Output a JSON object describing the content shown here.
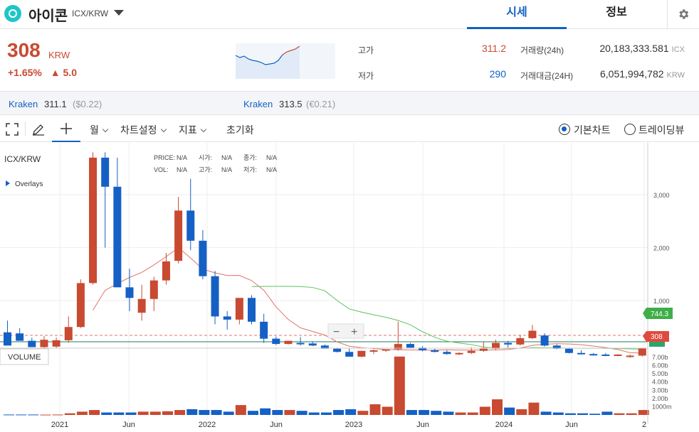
{
  "header": {
    "coin_name": "아이콘",
    "pair": "ICX/KRW",
    "tabs": [
      "시세",
      "정보"
    ],
    "active_tab": "시세"
  },
  "price": {
    "current": "308",
    "unit": "KRW",
    "change_pct": "+1.65%",
    "change_amount": "▲ 5.0"
  },
  "stats": {
    "high_label": "고가",
    "high": "311.2",
    "low_label": "저가",
    "low": "290",
    "volume_label": "거래량(24h)",
    "volume": "20,183,333.581",
    "volume_unit": "ICX",
    "amount_label": "거래대금(24H)",
    "amount": "6,051,994,782",
    "amount_unit": "KRW"
  },
  "exchanges": [
    {
      "name": "Kraken",
      "price": "311.1",
      "sub": "($0.22)"
    },
    {
      "name": "Kraken",
      "price": "313.5",
      "sub": "(€0.21)"
    }
  ],
  "toolbar": {
    "period": "월",
    "chart_settings": "차트설정",
    "indicators": "지표",
    "reset": "초기화",
    "basic_chart": "기본차트",
    "trading_view": "트레이딩뷰"
  },
  "chart_overlay": {
    "symbol": "ICX/KRW",
    "overlays": "Overlays",
    "price_label": "PRICE:",
    "price_val": "N/A",
    "open_label": "시가:",
    "open_val": "N/A",
    "close_label": "종가:",
    "close_val": "N/A",
    "vol_label": "VOL:",
    "vol_val": "N/A",
    "high_label": "고가:",
    "high_val": "N/A",
    "low_label": "저가:",
    "low_val": "N/A",
    "volume_panel": "VOLUME",
    "ma_badge": "744.3",
    "price_badge": "308",
    "zoom_out": "−",
    "zoom_in": "+"
  },
  "chart_data": {
    "type": "candlestick",
    "interval": "monthly",
    "price_ticks": [
      "3,000",
      "2,000",
      "1,000"
    ],
    "volume_ticks": [
      "7.00b",
      "6.00b",
      "5.00b",
      "4.00b",
      "3.00b",
      "2.00b",
      "1000m"
    ],
    "x_labels": [
      "2021",
      "Jun",
      "2022",
      "Jun",
      "2023",
      "Jun",
      "2024",
      "Jun",
      "2"
    ],
    "ylim": [
      0,
      3800
    ],
    "colors": {
      "up": "#c84a31",
      "down": "#1560c5",
      "ma_short": "#e0736a",
      "ma_long": "#5cc35f"
    },
    "candles": [
      {
        "o": 400,
        "h": 620,
        "l": 220,
        "c": 150
      },
      {
        "o": 380,
        "h": 480,
        "l": 300,
        "c": 240
      },
      {
        "o": 240,
        "h": 300,
        "l": 180,
        "c": 120
      },
      {
        "o": 120,
        "h": 330,
        "l": 100,
        "c": 260
      },
      {
        "o": 130,
        "h": 300,
        "l": 100,
        "c": 250
      },
      {
        "o": 250,
        "h": 700,
        "l": 200,
        "c": 500
      },
      {
        "o": 500,
        "h": 1400,
        "l": 480,
        "c": 1330
      },
      {
        "o": 1330,
        "h": 3800,
        "l": 1300,
        "c": 3700
      },
      {
        "o": 3700,
        "h": 3800,
        "l": 2000,
        "c": 3150
      },
      {
        "o": 3150,
        "h": 3700,
        "l": 1400,
        "c": 1250
      },
      {
        "o": 1250,
        "h": 1600,
        "l": 800,
        "c": 1050
      },
      {
        "o": 770,
        "h": 1300,
        "l": 620,
        "c": 1030
      },
      {
        "o": 1030,
        "h": 1450,
        "l": 800,
        "c": 1380
      },
      {
        "o": 1380,
        "h": 1900,
        "l": 1300,
        "c": 1740
      },
      {
        "o": 1750,
        "h": 2960,
        "l": 1700,
        "c": 2700
      },
      {
        "o": 2700,
        "h": 3300,
        "l": 1950,
        "c": 2130
      },
      {
        "o": 2130,
        "h": 2330,
        "l": 1400,
        "c": 1460
      },
      {
        "o": 1460,
        "h": 1560,
        "l": 550,
        "c": 700
      },
      {
        "o": 700,
        "h": 800,
        "l": 450,
        "c": 640
      },
      {
        "o": 640,
        "h": 1000,
        "l": 550,
        "c": 1050
      },
      {
        "o": 1050,
        "h": 1100,
        "l": 550,
        "c": 600
      },
      {
        "o": 600,
        "h": 750,
        "l": 200,
        "c": 280
      },
      {
        "o": 280,
        "h": 320,
        "l": 160,
        "c": 180
      },
      {
        "o": 180,
        "h": 240,
        "l": 170,
        "c": 240
      },
      {
        "o": 200,
        "h": 310,
        "l": 150,
        "c": 190
      },
      {
        "o": 190,
        "h": 230,
        "l": 140,
        "c": 150
      },
      {
        "o": 150,
        "h": 170,
        "l": 90,
        "c": 90
      },
      {
        "o": 90,
        "h": 100,
        "l": 20,
        "c": 30
      },
      {
        "o": 30,
        "h": 90,
        "l": 15,
        "c": -60
      },
      {
        "o": -60,
        "h": 50,
        "l": -70,
        "c": 50
      },
      {
        "o": 50,
        "h": 80,
        "l": -10,
        "c": 60
      },
      {
        "o": 60,
        "h": 80,
        "l": 30,
        "c": 80
      },
      {
        "o": 80,
        "h": 600,
        "l": 50,
        "c": 180
      },
      {
        "o": 180,
        "h": 200,
        "l": 100,
        "c": 110
      },
      {
        "o": 110,
        "h": 140,
        "l": 40,
        "c": 60
      },
      {
        "o": 60,
        "h": 90,
        "l": 20,
        "c": 30
      },
      {
        "o": 30,
        "h": 60,
        "l": -20,
        "c": -10
      },
      {
        "o": -10,
        "h": 20,
        "l": -30,
        "c": 10
      },
      {
        "o": 10,
        "h": 120,
        "l": -10,
        "c": 50
      },
      {
        "o": 50,
        "h": 220,
        "l": 30,
        "c": 90
      },
      {
        "o": 90,
        "h": 260,
        "l": 60,
        "c": 200
      },
      {
        "o": 200,
        "h": 240,
        "l": 110,
        "c": 170
      },
      {
        "o": 170,
        "h": 350,
        "l": 150,
        "c": 290
      },
      {
        "o": 290,
        "h": 540,
        "l": 270,
        "c": 430
      },
      {
        "o": 340,
        "h": 380,
        "l": 130,
        "c": 150
      },
      {
        "o": 150,
        "h": 170,
        "l": 80,
        "c": 90
      },
      {
        "o": 90,
        "h": 110,
        "l": 0,
        "c": 10
      },
      {
        "o": 10,
        "h": 60,
        "l": -20,
        "c": -10
      },
      {
        "o": -10,
        "h": 10,
        "l": -40,
        "c": -20
      },
      {
        "o": -20,
        "h": 10,
        "l": -50,
        "c": -40
      },
      {
        "o": -40,
        "h": -10,
        "l": -50,
        "c": -20
      },
      {
        "o": -60,
        "h": -20,
        "l": -80,
        "c": -40
      },
      {
        "o": -40,
        "h": 110,
        "l": -60,
        "c": 100
      }
    ],
    "ma_short": [
      null,
      null,
      null,
      null,
      null,
      null,
      null,
      null,
      null,
      null,
      null,
      null,
      null,
      null,
      null,
      null,
      null,
      null,
      null,
      null,
      null,
      null,
      null,
      null,
      null,
      null,
      null,
      null,
      null,
      null,
      null,
      null,
      null,
      null,
      null,
      null,
      null,
      null,
      null,
      null,
      null,
      null,
      null,
      null,
      null,
      null,
      null,
      null,
      null,
      null,
      null,
      null,
      null
    ],
    "ma_long_start": 20,
    "volumes": [
      0.05,
      0.05,
      0.05,
      0.04,
      0.05,
      0.2,
      0.4,
      0.6,
      0.3,
      0.3,
      0.3,
      0.4,
      0.4,
      0.45,
      0.6,
      0.7,
      0.6,
      0.6,
      0.4,
      1.2,
      0.5,
      0.8,
      0.6,
      0.6,
      0.5,
      0.3,
      0.3,
      0.6,
      0.7,
      0.5,
      1.3,
      1.0,
      7.1,
      0.6,
      0.6,
      0.5,
      0.4,
      0.3,
      0.3,
      1.0,
      1.9,
      0.9,
      0.7,
      1.5,
      0.4,
      0.3,
      0.2,
      0.2,
      0.15,
      0.4,
      0.2,
      0.2,
      0.6
    ]
  }
}
